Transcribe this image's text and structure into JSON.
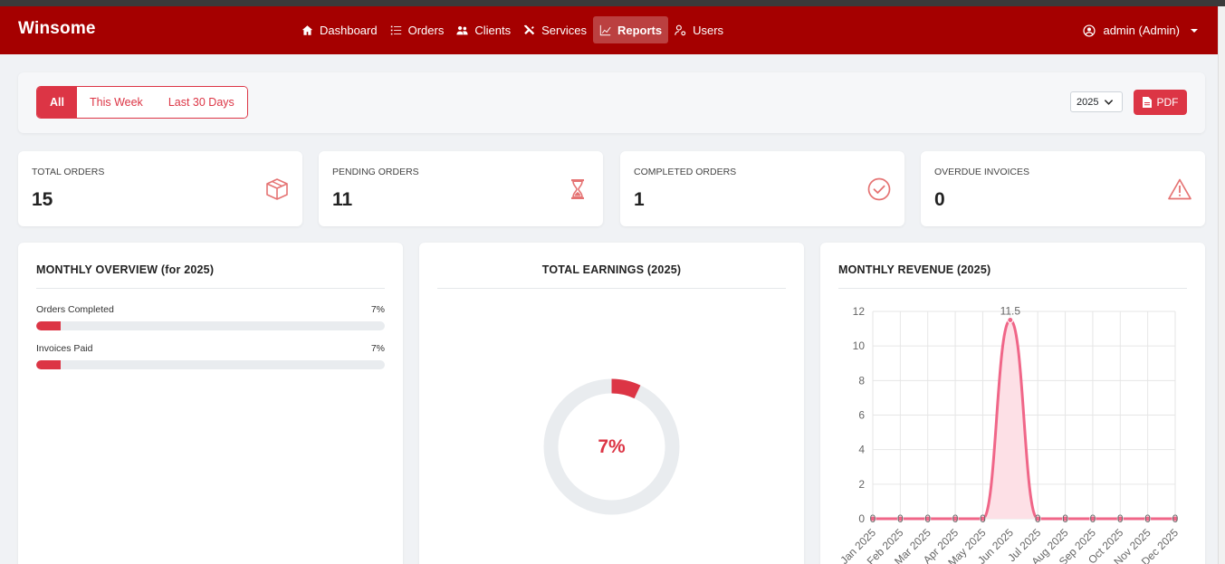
{
  "app": {
    "brand": "Winsome"
  },
  "nav": {
    "items": [
      {
        "label": "Dashboard",
        "icon": "home-icon"
      },
      {
        "label": "Orders",
        "icon": "list-icon"
      },
      {
        "label": "Clients",
        "icon": "users-icon"
      },
      {
        "label": "Services",
        "icon": "tools-icon"
      },
      {
        "label": "Reports",
        "icon": "chart-line-icon",
        "active": true
      },
      {
        "label": "Users",
        "icon": "user-cog-icon"
      }
    ],
    "user": "admin (Admin)"
  },
  "filters": {
    "ranges": [
      "All",
      "This Week",
      "Last 30 Days"
    ],
    "active_range": "All",
    "year": "2025",
    "pdf_label": "PDF"
  },
  "stats": [
    {
      "label": "TOTAL ORDERS",
      "value": "15",
      "icon": "box-icon"
    },
    {
      "label": "PENDING ORDERS",
      "value": "11",
      "icon": "hourglass-icon"
    },
    {
      "label": "COMPLETED ORDERS",
      "value": "1",
      "icon": "check-circle-icon"
    },
    {
      "label": "OVERDUE INVOICES",
      "value": "0",
      "icon": "warning-icon"
    }
  ],
  "monthly_overview": {
    "title": "MONTHLY OVERVIEW (for 2025)",
    "rows": [
      {
        "label": "Orders Completed",
        "pct_text": "7%",
        "fraction": 0.07
      },
      {
        "label": "Invoices Paid",
        "pct_text": "7%",
        "fraction": 0.07
      }
    ]
  },
  "earnings": {
    "title": "TOTAL EARNINGS (2025)",
    "pct_text": "7%",
    "fraction": 0.07
  },
  "revenue": {
    "title": "MONTHLY REVENUE (2025)"
  },
  "colors": {
    "brand": "#a50000",
    "accent": "#dc3545",
    "line": "#f06688",
    "fill": "#fde0e6"
  },
  "chart_data": {
    "type": "area",
    "title": "MONTHLY REVENUE (2025)",
    "categories": [
      "Jan 2025",
      "Feb 2025",
      "Mar 2025",
      "Apr 2025",
      "May 2025",
      "Jun 2025",
      "Jul 2025",
      "Aug 2025",
      "Sep 2025",
      "Oct 2025",
      "Nov 2025",
      "Dec 2025"
    ],
    "values": [
      0,
      0,
      0,
      0,
      0,
      11.5,
      0,
      0,
      0,
      0,
      0,
      0
    ],
    "data_labels": [
      "0",
      "0",
      "0",
      "0",
      "0",
      "11.5",
      "0",
      "0",
      "0",
      "0",
      "0",
      "0"
    ],
    "ylim": [
      0,
      12
    ],
    "yticks": [
      0,
      2,
      4,
      6,
      8,
      10,
      12
    ],
    "grid": true,
    "legend": "none"
  }
}
